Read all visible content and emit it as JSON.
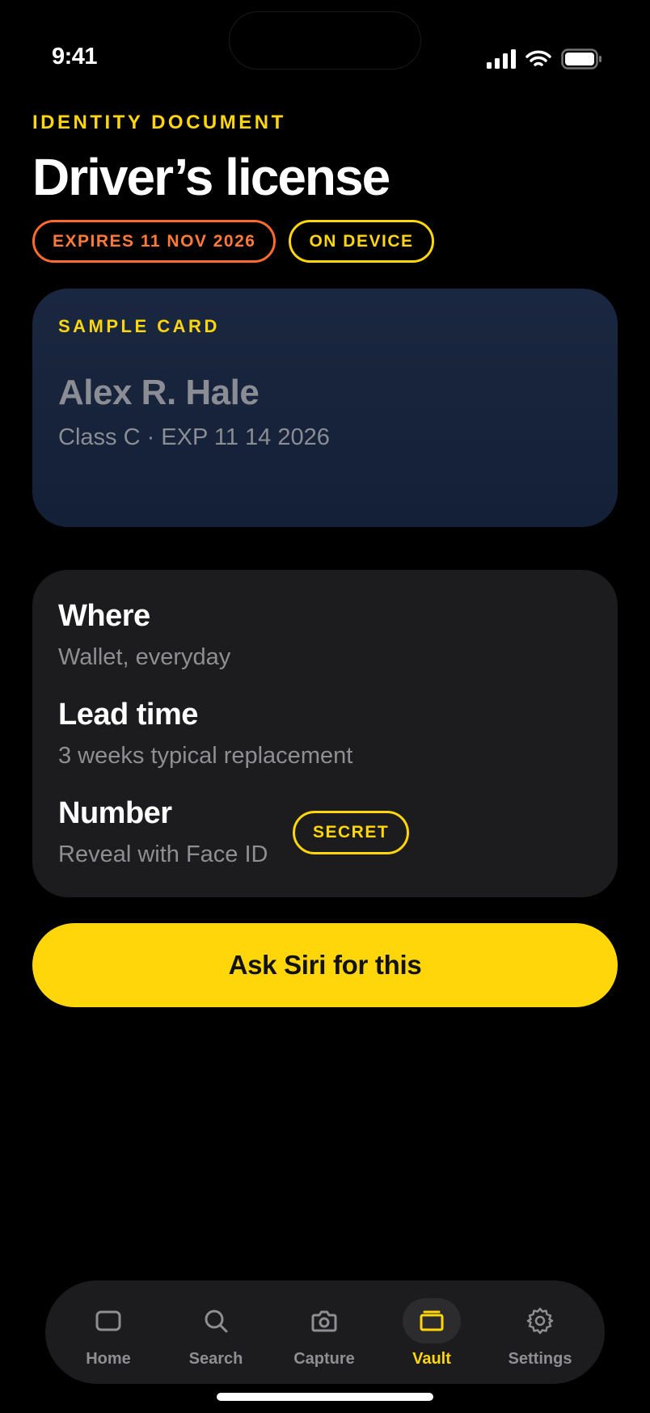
{
  "status": {
    "time": "9:41"
  },
  "header": {
    "eyebrow": "IDENTITY DOCUMENT",
    "title": "Driver’s license",
    "badges": {
      "expires": "EXPIRES 11 NOV 2026",
      "device": "ON DEVICE"
    }
  },
  "sample_card": {
    "label": "SAMPLE CARD",
    "name": "Alex R. Hale",
    "details": "Class C · EXP 11 14 2026"
  },
  "info": {
    "where": {
      "label": "Where",
      "value": "Wallet, everyday"
    },
    "lead_time": {
      "label": "Lead time",
      "value": "3 weeks typical replacement"
    },
    "number": {
      "label": "Number",
      "value": "Reveal with Face ID",
      "chip": "SECRET"
    }
  },
  "primary_action": {
    "label": "Ask Siri for this"
  },
  "tabs": [
    {
      "label": "Home",
      "icon": "home-icon"
    },
    {
      "label": "Search",
      "icon": "search-icon"
    },
    {
      "label": "Capture",
      "icon": "camera-icon"
    },
    {
      "label": "Vault",
      "icon": "vault-icon",
      "active": true
    },
    {
      "label": "Settings",
      "icon": "gear-icon"
    }
  ],
  "colors": {
    "accent": "#FFD60A",
    "warning": "#FF6B2C",
    "card": "#1c1c1e",
    "sample_card": "#172339"
  }
}
